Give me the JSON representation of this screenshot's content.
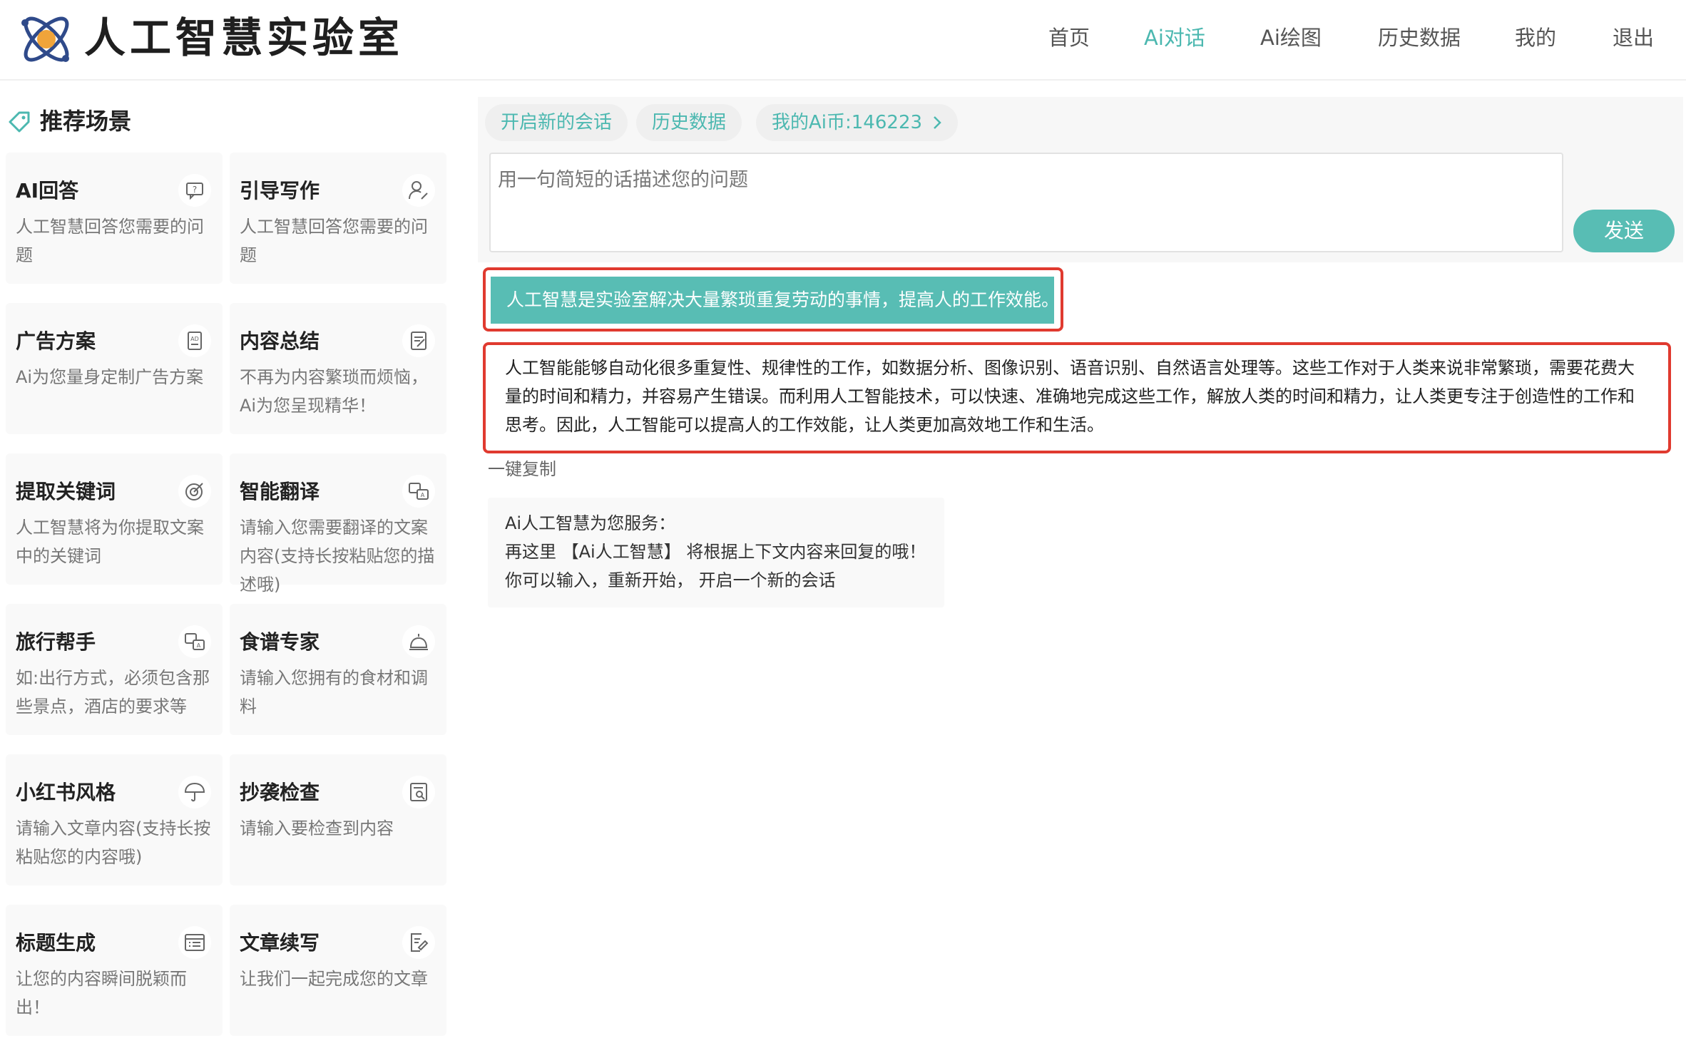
{
  "header": {
    "site_title": "人工智慧实验室",
    "nav": [
      {
        "label": "首页",
        "active": false
      },
      {
        "label": "Ai对话",
        "active": true
      },
      {
        "label": "Ai绘图",
        "active": false
      },
      {
        "label": "历史数据",
        "active": false
      },
      {
        "label": "我的",
        "active": false
      },
      {
        "label": "退出",
        "active": false
      }
    ]
  },
  "sidebar": {
    "title": "推荐场景",
    "cards": [
      {
        "title": "AI回答",
        "desc": "人工智慧回答您需要的问题",
        "icon": "chat-question-icon"
      },
      {
        "title": "引导写作",
        "desc": "人工智慧回答您需要的问题",
        "icon": "user-pen-icon"
      },
      {
        "title": "广告方案",
        "desc": "Ai为您量身定制广告方案",
        "icon": "ad-doc-icon"
      },
      {
        "title": "内容总结",
        "desc": "不再为内容繁琐而烦恼，Ai为您呈现精华！",
        "icon": "doc-edit-icon"
      },
      {
        "title": "提取关键词",
        "desc": "人工智慧将为你提取文案中的关键词",
        "icon": "target-icon"
      },
      {
        "title": "智能翻译",
        "desc": "请输入您需要翻译的文案内容(支持长按粘贴您的描述哦)",
        "icon": "translate-icon"
      },
      {
        "title": "旅行帮手",
        "desc": "如:出行方式，必须包含那些景点，酒店的要求等",
        "icon": "translate-icon"
      },
      {
        "title": "食谱专家",
        "desc": "请输入您拥有的食材和调料",
        "icon": "cloche-icon"
      },
      {
        "title": "小红书风格",
        "desc": "请输入文章内容(支持长按粘贴您的内容哦)",
        "icon": "umbrella-icon"
      },
      {
        "title": "抄袭检查",
        "desc": "请输入要检查到内容",
        "icon": "doc-search-icon"
      },
      {
        "title": "标题生成",
        "desc": "让您的内容瞬间脱颖而出！",
        "icon": "list-icon"
      },
      {
        "title": "文章续写",
        "desc": "让我们一起完成您的文章",
        "icon": "doc-write-icon"
      }
    ]
  },
  "chat": {
    "new_session": "开启新的会话",
    "history": "历史数据",
    "coins": "我的Ai币:146223",
    "placeholder": "用一句简短的话描述您的问题",
    "send_label": "发送",
    "user_message": "人工智慧是实验室解决大量繁琐重复劳动的事情，提高人的工作效能。",
    "answer_lines": [
      "人工智能能够自动化很多重复性、规律性的工作，如数据分析、图像识别、语音识别、自然语言处理等。这些工作对于人类来说非常繁琐，需要花费大",
      "量的时间和精力，并容易产生错误。而利用人工智能技术，可以快速、准确地完成这些工作，解放人类的时间和精力，让人类更专注于创造性的工作和",
      "思考。因此，人工智能可以提高人的工作效能，让人类更加高效地工作和生活。"
    ],
    "copy_label": "一键复制",
    "ai_intro": [
      "Ai人工智慧为您服务：",
      "再这里 【Ai人工智慧】 将根据上下文内容来回复的哦！",
      "你可以输入，重新开始， 开启一个新的会话"
    ]
  },
  "colors": {
    "accent": "#4cb8b0",
    "button": "#58bdb4",
    "highlight_border": "#e03a2f"
  }
}
